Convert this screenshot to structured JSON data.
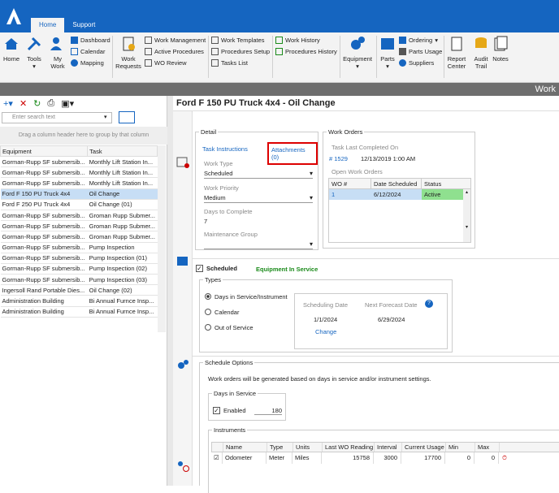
{
  "tabs": [
    "Home",
    "Support"
  ],
  "ribbon": {
    "home": "Home",
    "tools": "Tools",
    "my_work": "My Work",
    "work_requests": "Work Requests",
    "dashboard": "Dashboard",
    "calendar": "Calendar",
    "mapping": "Mapping",
    "work_management": "Work Management",
    "active_procedures": "Active Procedures",
    "wo_review": "WO Review",
    "work_templates": "Work Templates",
    "procedures_setup": "Procedures Setup",
    "tasks_list": "Tasks List",
    "work_history": "Work History",
    "procedures_history": "Procedures History",
    "equipment": "Equipment",
    "parts": "Parts",
    "ordering": "Ordering",
    "parts_usage": "Parts Usage",
    "suppliers": "Suppliers",
    "report_center": "Report Center",
    "audit_trail": "Audit Trail",
    "notes": "Notes"
  },
  "header2": "Work",
  "left": {
    "search_placeholder": "Enter search text",
    "group_hint": "Drag a column header here to group by that column",
    "columns": [
      "Equipment",
      "Task"
    ],
    "rows": [
      [
        "Gorman-Rupp SF submersib...",
        "Monthly Lift Station In..."
      ],
      [
        "Gorman-Rupp SF submersib...",
        "Monthly Lift Station In..."
      ],
      [
        "Gorman-Rupp SF submersib...",
        "Monthly Lift Station In..."
      ],
      [
        "Ford F 150 PU Truck 4x4",
        "Oil Change"
      ],
      [
        "Ford F 250 PU Truck 4x4",
        "Oil Change (01)"
      ],
      [
        "Gorman-Rupp SF submersib...",
        "Groman Rupp Submer..."
      ],
      [
        "Gorman-Rupp SF submersib...",
        "Groman Rupp Submer..."
      ],
      [
        "Gorman-Rupp SF submersib...",
        "Groman Rupp Submer..."
      ],
      [
        "Gorman-Rupp SF submersib...",
        "Pump Inspection"
      ],
      [
        "Gorman-Rupp SF submersib...",
        "Pump Inspection (01)"
      ],
      [
        "Gorman-Rupp SF submersib...",
        "Pump Inspection (02)"
      ],
      [
        "Gorman-Rupp SF submersib...",
        "Pump Inspection (03)"
      ],
      [
        "Ingersoll Rand Portable Dies...",
        "Oil Change (02)"
      ],
      [
        "Administration Building",
        "Bi Annual Furnce Insp..."
      ],
      [
        "Administration Building",
        "Bi Annual Furnce Insp..."
      ]
    ]
  },
  "main": {
    "title": "Ford F 150 PU Truck 4x4 - Oil Change",
    "detail": {
      "legend": "Detail",
      "task_instructions": "Task Instructions",
      "attachments": "Attachments (0)",
      "work_type_label": "Work Type",
      "work_type": "Scheduled",
      "priority_label": "Work Priority",
      "priority": "Medium",
      "days_label": "Days to Complete",
      "days": "7",
      "mgroup_label": "Maintenance Group"
    },
    "work_orders": {
      "legend": "Work Orders",
      "last_completed_label": "Task Last Completed On",
      "last_wo": "# 1529",
      "last_date": "12/13/2019 1:00 AM",
      "open_label": "Open Work Orders",
      "cols": [
        "WO #",
        "Date Scheduled",
        "Status"
      ],
      "row": [
        "1",
        "6/12/2024",
        "Active"
      ]
    },
    "scheduled": {
      "label": "Scheduled",
      "status": "Equipment In Service",
      "types_legend": "Types",
      "opt1": "Days in Service/Instrument",
      "opt2": "Calendar",
      "opt3": "Out of Service",
      "sched_date_label": "Scheduling Date",
      "sched_date": "1/1/2024",
      "change": "Change",
      "next_label": "Next Forecast Date",
      "next_date": "6/29/2024"
    },
    "options": {
      "legend": "Schedule Options",
      "note": "Work orders will be generated based on days in service and/or instrument settings.",
      "dis_legend": "Days in Service",
      "enabled": "Enabled",
      "days": "180",
      "instr_legend": "Instruments",
      "cols": [
        "Name",
        "Type",
        "Units",
        "Last WO Reading",
        "Interval",
        "Current Usage",
        "Min",
        "Max"
      ],
      "row": [
        "Odometer",
        "Meter",
        "Miles",
        "15758",
        "3000",
        "17700",
        "0",
        "0"
      ]
    }
  }
}
